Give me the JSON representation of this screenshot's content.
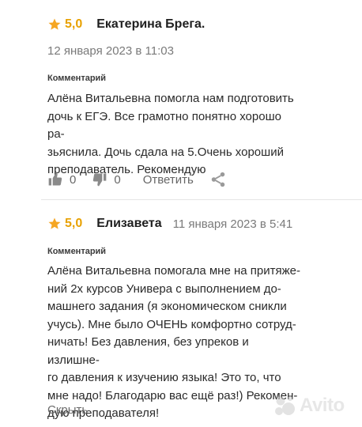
{
  "reviews": [
    {
      "rating": "5,0",
      "author": "Екатерина Брега.",
      "date": "12 января 2023 в 11:03",
      "comment_label": "Комментарий",
      "comment_lines": [
        "Алёна Витальевна помогла нам подготовить",
        "дочь к ЕГЭ. Все грамотно понятно хорошо ра-",
        "зьяснила. Дочь сдала на 5.Очень хороший",
        "преподаватель. Рекомендую"
      ],
      "likes": "0",
      "dislikes": "0",
      "reply_label": "Ответить"
    },
    {
      "rating": "5,0",
      "author": "Елизавета",
      "date": "11 января 2023 в 5:41",
      "comment_label": "Комментарий",
      "comment_lines": [
        "Алёна Витальевна помогала мне на притяже-",
        "ний 2х курсов Универа с выполнением до-",
        "машнего задания (я экономическом сникли",
        "учусь). Мне было ОЧЕНЬ комфортно сотруд-",
        "ничать! Без давления, без упреков и излишне-",
        "го давления к изучению языка! Это то, что",
        "мне надо! Благодарю вас ещё раз!) Рекомен-",
        "дую преподавателя!"
      ],
      "hide_label": "Скрыть"
    }
  ],
  "watermark": {
    "text": "Avito"
  },
  "colors": {
    "star": "#f5a623",
    "rating": "#e8a100",
    "muted": "#7a7a7a"
  },
  "icons": [
    "star-icon",
    "thumbs-up-icon",
    "thumbs-down-icon",
    "share-icon",
    "avito-logo-icon"
  ]
}
